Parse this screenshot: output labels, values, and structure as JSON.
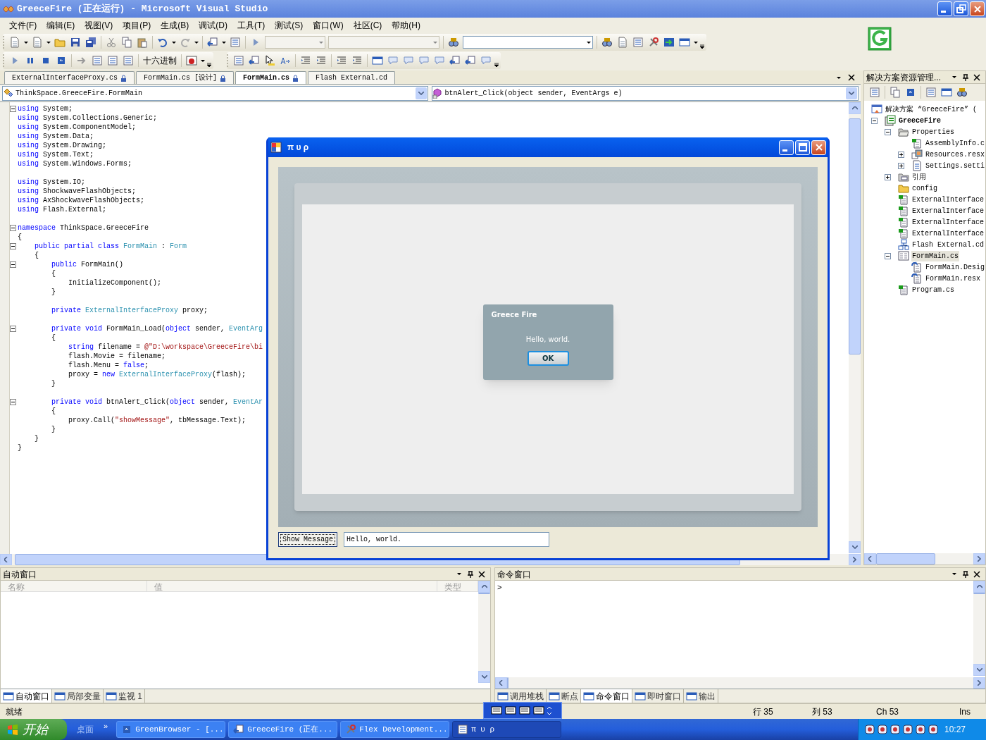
{
  "window": {
    "title": "GreeceFire (正在运行) - Microsoft Visual Studio"
  },
  "menu": [
    "文件(F)",
    "编辑(E)",
    "视图(V)",
    "项目(P)",
    "生成(B)",
    "调试(D)",
    "工具(T)",
    "测试(S)",
    "窗口(W)",
    "社区(C)",
    "帮助(H)"
  ],
  "toolbar": {
    "hex_button": "十六进制"
  },
  "editor": {
    "tabs": [
      {
        "label": "ExternalInterfaceProxy.cs",
        "locked": true,
        "selected": false
      },
      {
        "label": "FormMain.cs [设计]",
        "locked": true,
        "selected": false
      },
      {
        "label": "FormMain.cs",
        "locked": true,
        "selected": true
      },
      {
        "label": "Flash External.cd",
        "locked": false,
        "selected": false
      }
    ],
    "type_combo": "ThinkSpace.GreeceFire.FormMain",
    "member_combo": "btnAlert_Click(object sender, EventArgs e)",
    "lines": [
      {
        "kind": "code",
        "fold": true,
        "tokens": [
          {
            "text": "using",
            "kind": "kw"
          },
          {
            "text": " System;",
            "kind": "plain"
          }
        ]
      },
      {
        "kind": "code",
        "tokens": [
          {
            "text": "using",
            "kind": "kw"
          },
          {
            "text": " System.Collections.Generic;",
            "kind": "plain"
          }
        ]
      },
      {
        "kind": "code",
        "tokens": [
          {
            "text": "using",
            "kind": "kw"
          },
          {
            "text": " System.ComponentModel;",
            "kind": "plain"
          }
        ]
      },
      {
        "kind": "code",
        "tokens": [
          {
            "text": "using",
            "kind": "kw"
          },
          {
            "text": " System.Data;",
            "kind": "plain"
          }
        ]
      },
      {
        "kind": "code",
        "tokens": [
          {
            "text": "using",
            "kind": "kw"
          },
          {
            "text": " System.Drawing;",
            "kind": "plain"
          }
        ]
      },
      {
        "kind": "code",
        "tokens": [
          {
            "text": "using",
            "kind": "kw"
          },
          {
            "text": " System.Text;",
            "kind": "plain"
          }
        ]
      },
      {
        "kind": "code",
        "tokens": [
          {
            "text": "using",
            "kind": "kw"
          },
          {
            "text": " System.Windows.Forms;",
            "kind": "plain"
          }
        ]
      },
      {
        "kind": "blank"
      },
      {
        "kind": "code",
        "tokens": [
          {
            "text": "using",
            "kind": "kw"
          },
          {
            "text": " System.IO;",
            "kind": "plain"
          }
        ]
      },
      {
        "kind": "code",
        "tokens": [
          {
            "text": "using",
            "kind": "kw"
          },
          {
            "text": " ShockwaveFlashObjects;",
            "kind": "plain"
          }
        ]
      },
      {
        "kind": "code",
        "tokens": [
          {
            "text": "using",
            "kind": "kw"
          },
          {
            "text": " AxShockwaveFlashObjects;",
            "kind": "plain"
          }
        ]
      },
      {
        "kind": "code",
        "tokens": [
          {
            "text": "using",
            "kind": "kw"
          },
          {
            "text": " Flash.External;",
            "kind": "plain"
          }
        ]
      },
      {
        "kind": "blank"
      },
      {
        "kind": "code",
        "fold": true,
        "tokens": [
          {
            "text": "namespace",
            "kind": "kw"
          },
          {
            "text": " ThinkSpace.GreeceFire",
            "kind": "plain"
          }
        ]
      },
      {
        "kind": "code",
        "tokens": [
          {
            "text": "{",
            "kind": "plain"
          }
        ]
      },
      {
        "kind": "code",
        "fold": true,
        "tokens": [
          {
            "text": "    public partial class",
            "kind": "kw"
          },
          {
            "text": " FormMain",
            "kind": "type"
          },
          {
            "text": " : ",
            "kind": "plain"
          },
          {
            "text": "Form",
            "kind": "type"
          }
        ]
      },
      {
        "kind": "code",
        "tokens": [
          {
            "text": "    {",
            "kind": "plain"
          }
        ]
      },
      {
        "kind": "code",
        "fold": true,
        "tokens": [
          {
            "text": "        public",
            "kind": "kw"
          },
          {
            "text": " FormMain()",
            "kind": "plain"
          }
        ]
      },
      {
        "kind": "code",
        "tokens": [
          {
            "text": "        {",
            "kind": "plain"
          }
        ]
      },
      {
        "kind": "code",
        "tokens": [
          {
            "text": "            InitializeComponent();",
            "kind": "plain"
          }
        ]
      },
      {
        "kind": "code",
        "tokens": [
          {
            "text": "        }",
            "kind": "plain"
          }
        ]
      },
      {
        "kind": "blank"
      },
      {
        "kind": "code",
        "tokens": [
          {
            "text": "        private",
            "kind": "kw"
          },
          {
            "text": " ExternalInterfaceProxy",
            "kind": "type"
          },
          {
            "text": " proxy;",
            "kind": "plain"
          }
        ]
      },
      {
        "kind": "blank"
      },
      {
        "kind": "code",
        "fold": true,
        "tokens": [
          {
            "text": "        private void",
            "kind": "kw"
          },
          {
            "text": " FormMain_Load(",
            "kind": "plain"
          },
          {
            "text": "object",
            "kind": "kw"
          },
          {
            "text": " sender, ",
            "kind": "plain"
          },
          {
            "text": "EventArg",
            "kind": "type"
          }
        ]
      },
      {
        "kind": "code",
        "tokens": [
          {
            "text": "        {",
            "kind": "plain"
          }
        ]
      },
      {
        "kind": "code",
        "tokens": [
          {
            "text": "            string",
            "kind": "kw"
          },
          {
            "text": " filename = ",
            "kind": "plain"
          },
          {
            "text": "@\"D:\\workspace\\GreeceFire\\bi",
            "kind": "str"
          }
        ]
      },
      {
        "kind": "code",
        "tokens": [
          {
            "text": "            flash.Movie = filename;",
            "kind": "plain"
          }
        ]
      },
      {
        "kind": "code",
        "tokens": [
          {
            "text": "            flash.Menu = ",
            "kind": "plain"
          },
          {
            "text": "false",
            "kind": "kw"
          },
          {
            "text": ";",
            "kind": "plain"
          }
        ]
      },
      {
        "kind": "code",
        "tokens": [
          {
            "text": "            proxy = ",
            "kind": "plain"
          },
          {
            "text": "new",
            "kind": "kw"
          },
          {
            "text": " ExternalInterfaceProxy",
            "kind": "type"
          },
          {
            "text": "(flash);",
            "kind": "plain"
          }
        ]
      },
      {
        "kind": "code",
        "tokens": [
          {
            "text": "        }",
            "kind": "plain"
          }
        ]
      },
      {
        "kind": "blank"
      },
      {
        "kind": "code",
        "fold": true,
        "tokens": [
          {
            "text": "        private void",
            "kind": "kw"
          },
          {
            "text": " btnAlert_Click(",
            "kind": "plain"
          },
          {
            "text": "object",
            "kind": "kw"
          },
          {
            "text": " sender, ",
            "kind": "plain"
          },
          {
            "text": "EventAr",
            "kind": "type"
          }
        ]
      },
      {
        "kind": "code",
        "tokens": [
          {
            "text": "        {",
            "kind": "plain"
          }
        ]
      },
      {
        "kind": "code",
        "tokens": [
          {
            "text": "            proxy.Call(",
            "kind": "plain"
          },
          {
            "text": "\"showMessage\"",
            "kind": "str"
          },
          {
            "text": ", tbMessage.Text);",
            "kind": "plain"
          }
        ]
      },
      {
        "kind": "code",
        "tokens": [
          {
            "text": "        }",
            "kind": "plain"
          }
        ]
      },
      {
        "kind": "code",
        "tokens": [
          {
            "text": "    }",
            "kind": "plain"
          }
        ]
      },
      {
        "kind": "code",
        "tokens": [
          {
            "text": "}",
            "kind": "plain"
          }
        ]
      }
    ]
  },
  "solution_explorer": {
    "title": "解决方案资源管理...",
    "tree": [
      {
        "label": "解决方案 “GreeceFire” (",
        "kind": "solution",
        "selected": false,
        "children": [
          {
            "label": "GreeceFire",
            "kind": "project",
            "expanded": true,
            "selected": false,
            "children": [
              {
                "label": "Properties",
                "kind": "folder-open",
                "expanded": true,
                "selected": false,
                "children": [
                  {
                    "label": "AssemblyInfo.c",
                    "kind": "cs",
                    "selected": false
                  },
                  {
                    "label": "Resources.resx",
                    "kind": "resx",
                    "expanded": false,
                    "selected": false
                  },
                  {
                    "label": "Settings.setti",
                    "kind": "settings",
                    "expanded": false,
                    "selected": false
                  }
                ]
              },
              {
                "label": "引用",
                "kind": "refs",
                "expanded": false,
                "selected": false
              },
              {
                "label": "config",
                "kind": "folder",
                "selected": false
              },
              {
                "label": "ExternalInterface",
                "kind": "cs",
                "selected": false
              },
              {
                "label": "ExternalInterface",
                "kind": "cs",
                "selected": false
              },
              {
                "label": "ExternalInterface",
                "kind": "cs",
                "selected": false
              },
              {
                "label": "ExternalInterface",
                "kind": "cs",
                "selected": false
              },
              {
                "label": "Flash External.cd",
                "kind": "diagram",
                "selected": false
              },
              {
                "label": "FormMain.cs",
                "kind": "form",
                "expanded": true,
                "selected": true,
                "children": [
                  {
                    "label": "FormMain.Desig",
                    "kind": "cs-sub",
                    "selected": false
                  },
                  {
                    "label": "FormMain.resx",
                    "kind": "cs-sub",
                    "selected": false
                  }
                ]
              },
              {
                "label": "Program.cs",
                "kind": "cs",
                "selected": false
              }
            ]
          }
        ]
      }
    ]
  },
  "running_form": {
    "title": "π υ ρ",
    "flash_dialog": {
      "title": "Greece Fire",
      "message": "Hello, world.",
      "button": "OK"
    },
    "show_button": "Show Message",
    "message_field": "Hello, world."
  },
  "autos_window": {
    "title": "自动窗口",
    "columns": [
      "名称",
      "值",
      "类型"
    ],
    "tabs": [
      {
        "label": "自动窗口",
        "selected": true
      },
      {
        "label": "局部变量",
        "selected": false
      },
      {
        "label": "监视 1",
        "selected": false
      }
    ]
  },
  "command_window": {
    "title": "命令窗口",
    "prompt": ">",
    "tabs": [
      {
        "label": "调用堆栈",
        "selected": false
      },
      {
        "label": "断点",
        "selected": false
      },
      {
        "label": "命令窗口",
        "selected": true
      },
      {
        "label": "即时窗口",
        "selected": false
      },
      {
        "label": "输出",
        "selected": false
      }
    ]
  },
  "status_bar": {
    "status": "就绪",
    "line": "行 35",
    "column": "列 53",
    "char": "Ch 53",
    "mode": "Ins"
  },
  "taskbar": {
    "start": "开始",
    "quick_launch": "桌面",
    "overflow": "»",
    "buttons": [
      {
        "label": "GreenBrowser - [...",
        "selected": false
      },
      {
        "label": "GreeceFire (正在...",
        "selected": false
      },
      {
        "label": "Flex Development...",
        "selected": false
      },
      {
        "label": "π υ ρ",
        "selected": true
      }
    ],
    "clock": "10:27"
  }
}
